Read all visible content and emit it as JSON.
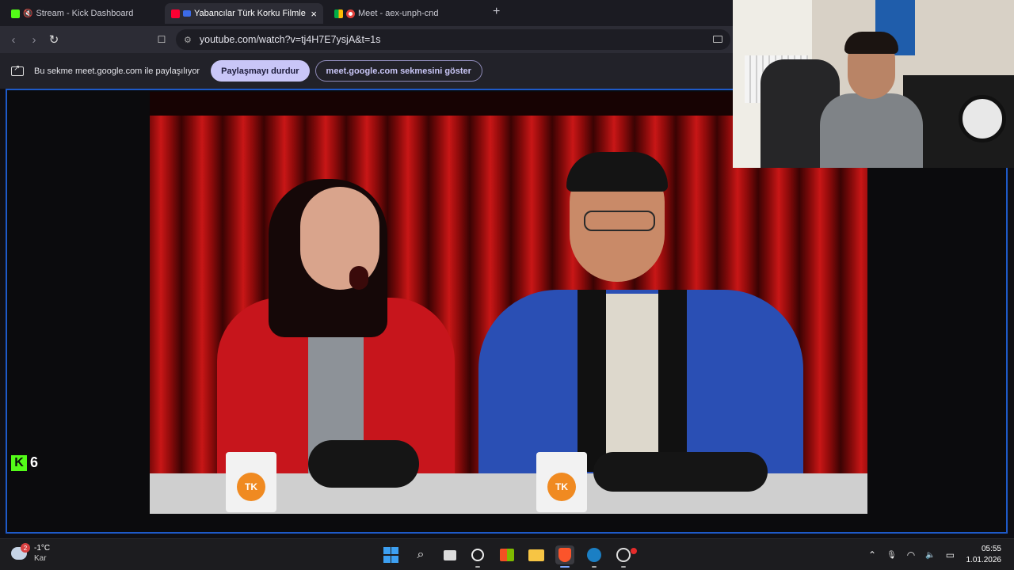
{
  "browser": {
    "tabs": [
      {
        "title": "Stream - Kick Dashboard",
        "favicon": "kick-icon",
        "favicon_color": "#53fc18",
        "muted": true
      },
      {
        "title": "Yabancılar Türk Korku Filmleri",
        "favicon": "youtube-icon",
        "favicon_color": "#ff0033",
        "active": true,
        "close": "×"
      },
      {
        "title": "Meet - aex-unph-cnd",
        "favicon": "meet-icon",
        "favicon_color": "#00ac47",
        "recording": true
      }
    ],
    "new_tab": "+",
    "nav": {
      "back": "‹",
      "forward": "›",
      "reload": "↻",
      "bookmark": "☐"
    },
    "url": "youtube.com/watch?v=tj4H7E7ysjA&t=1s"
  },
  "sharebar": {
    "message": "Bu sekme meet.google.com ile paylaşılıyor",
    "stop_label": "Paylaşmayı durdur",
    "show_label": "meet.google.com sekmesini göster"
  },
  "video": {
    "mug_logo": "TK",
    "frame_color": "#1e5ac8"
  },
  "kick": {
    "logo": "K",
    "viewer_count": "6",
    "color": "#53fc18"
  },
  "taskbar": {
    "weather": {
      "badge": "2",
      "temp": "-1°C",
      "desc": "Kar"
    },
    "pinned": [
      "windows-start-icon",
      "search-icon",
      "task-view-icon",
      "chatgpt-icon",
      "store-icon",
      "file-explorer-icon",
      "brave-icon",
      "steam-icon",
      "app-icon"
    ],
    "search_glyph": "⌕",
    "tray": {
      "chevron": "⌃",
      "mic": "🎙",
      "wifi": "◠",
      "volume": "🔈",
      "battery": "▭"
    },
    "clock": {
      "time": "05:55",
      "date": "1.01.2026"
    }
  }
}
